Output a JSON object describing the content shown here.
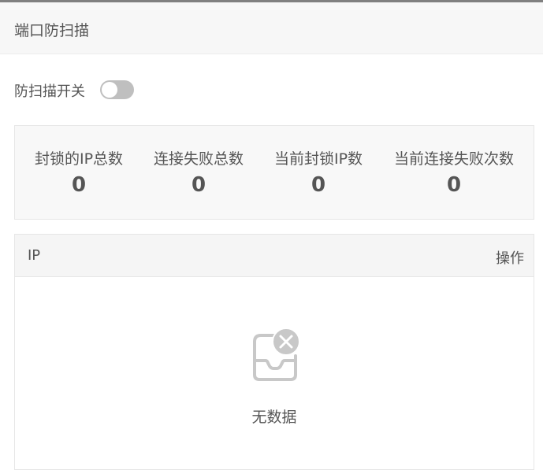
{
  "panel": {
    "title": "端口防扫描"
  },
  "toggle": {
    "label": "防扫描开关",
    "state": "off"
  },
  "stats": [
    {
      "label": "封锁的IP总数",
      "value": "0"
    },
    {
      "label": "连接失败总数",
      "value": "0"
    },
    {
      "label": "当前封锁IP数",
      "value": "0"
    },
    {
      "label": "当前连接失败次数",
      "value": "0"
    }
  ],
  "table": {
    "columns": [
      "IP",
      "操作"
    ],
    "rows": [],
    "empty_text": "无数据"
  },
  "icons": {
    "empty": "empty-inbox-icon",
    "empty_badge": "close-circle-icon"
  },
  "colors": {
    "toggle_off": "#bfbfbf",
    "header_bg": "#f7f7f7",
    "text": "#555555"
  }
}
